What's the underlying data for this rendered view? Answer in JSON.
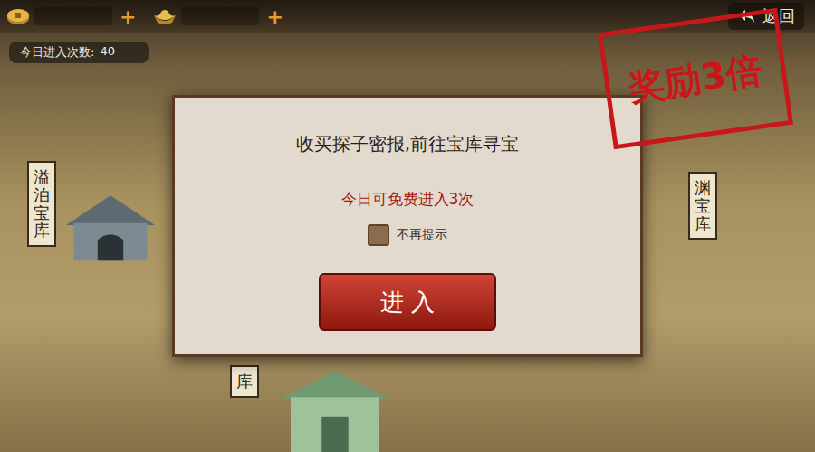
{
  "top_bar": {
    "currencies": [
      {
        "kind": "coin",
        "plus": "+"
      },
      {
        "kind": "ingot",
        "plus": "+"
      }
    ],
    "back_label": "返回"
  },
  "entries_today": {
    "label": "今日进入次数:",
    "count": "40"
  },
  "map_labels": [
    {
      "text": "溢泊宝库",
      "place": "left"
    },
    {
      "text": "渊宝库",
      "place": "right"
    },
    {
      "text": "库",
      "place": "bottom"
    }
  ],
  "dialog": {
    "title": "收买探子密报,前往宝库寻宝",
    "free_info": "今日可免费进入3次",
    "checkbox": {
      "label": "不再提示",
      "checked": false
    },
    "button": "进 入"
  },
  "stamp": "奖励3倍"
}
